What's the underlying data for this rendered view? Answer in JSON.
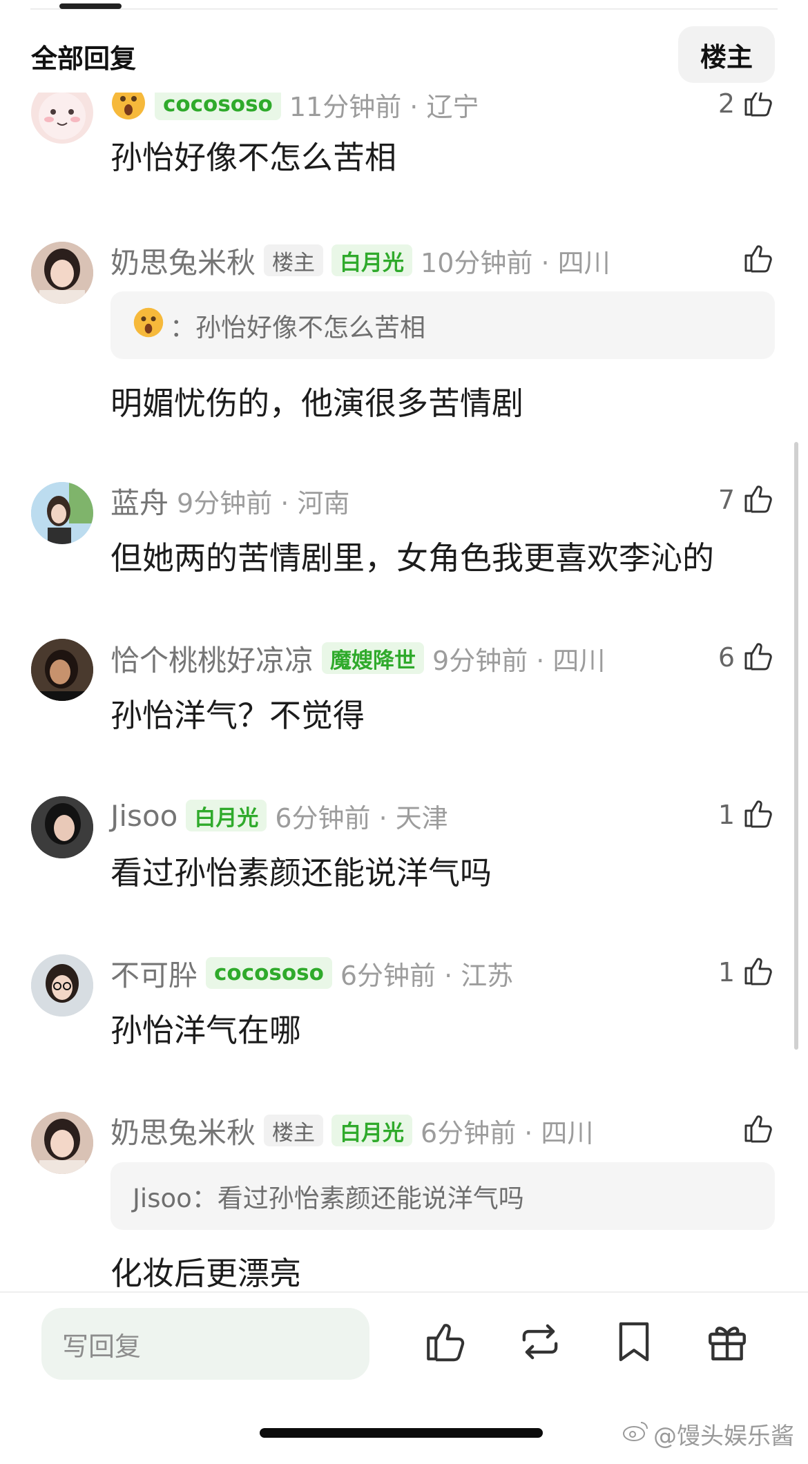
{
  "header": {
    "title": "全部回复",
    "owner_filter_label": "楼主"
  },
  "comments": [
    {
      "username": "cocososo",
      "time": "11分钟前",
      "location": "辽宁",
      "meta_text": "11分钟前 · 辽宁",
      "likes": "2",
      "text": "孙怡好像不怎么苦相"
    },
    {
      "username": "奶思兔米秋",
      "owner_badge": "楼主",
      "badge": "白月光",
      "time": "10分钟前",
      "location": "四川",
      "meta_text": "10分钟前 · 四川",
      "likes": "",
      "quote": "：孙怡好像不怎么苦相",
      "text": "明媚忧伤的，他演很多苦情剧"
    },
    {
      "username": "蓝舟",
      "time": "9分钟前",
      "location": "河南",
      "meta_text": "9分钟前 · 河南",
      "likes": "7",
      "text": "但她两的苦情剧里，女角色我更喜欢李沁的"
    },
    {
      "username": "恰个桃桃好凉凉",
      "badge": "魔嫂降世",
      "time": "9分钟前",
      "location": "四川",
      "meta_text": "9分钟前 · 四川",
      "likes": "6",
      "text": "孙怡洋气？不觉得"
    },
    {
      "username": "Jisoo",
      "badge": "白月光",
      "time": "6分钟前",
      "location": "天津",
      "meta_text": "6分钟前 · 天津",
      "likes": "1",
      "text": "看过孙怡素颜还能说洋气吗"
    },
    {
      "username": "不可肸",
      "badge": "cocososo",
      "time": "6分钟前",
      "location": "江苏",
      "meta_text": "6分钟前 · 江苏",
      "likes": "1",
      "text": "孙怡洋气在哪"
    },
    {
      "username": "奶思兔米秋",
      "owner_badge": "楼主",
      "badge": "白月光",
      "time": "6分钟前",
      "location": "四川",
      "meta_text": "6分钟前 · 四川",
      "likes": "",
      "quote": "Jisoo：看过孙怡素颜还能说洋气吗",
      "text": "化妆后更漂亮"
    }
  ],
  "bottom_bar": {
    "reply_placeholder": "写回复"
  },
  "watermark": "@馒头娱乐酱",
  "colors": {
    "badge_green": "#2faa2b",
    "badge_green_bg": "#e9f7e7",
    "reply_bg": "#eef4ef"
  },
  "icons": [
    "thumb-up-icon",
    "repost-icon",
    "bookmark-icon",
    "gift-icon",
    "weibo-logo-icon",
    "surprised-emoji-icon"
  ]
}
